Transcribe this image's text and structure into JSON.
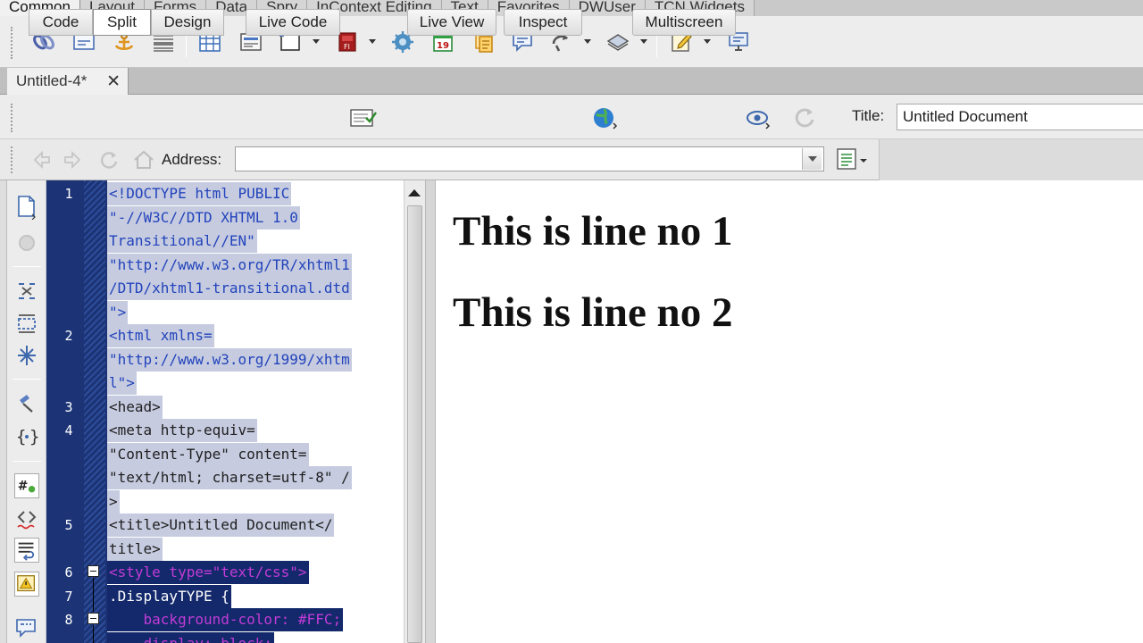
{
  "insert_bar": {
    "tabs": [
      "Common",
      "Layout",
      "Forms",
      "Data",
      "Spry",
      "InContext Editing",
      "Text",
      "Favorites",
      "DWUser",
      "TCN Widgets"
    ],
    "active_tab": "Common",
    "icons": [
      "hyperlink-icon",
      "email-link-icon",
      "named-anchor-icon",
      "horizontal-rule-icon",
      "table-icon",
      "insert-div-icon",
      "images-icon",
      "media-icon",
      "widget-icon",
      "date-icon",
      "server-side-include-icon",
      "comment-icon",
      "head-icon",
      "script-icon",
      "templates-icon",
      "tag-chooser-icon",
      "browser-check-icon"
    ]
  },
  "document": {
    "tab_name": "Untitled-4*",
    "close_glyph": "✕"
  },
  "doc_toolbar": {
    "code_label": "Code",
    "split_label": "Split",
    "design_label": "Design",
    "live_code_label": "Live Code",
    "live_view_label": "Live View",
    "inspect_label": "Inspect",
    "multiscreen_label": "Multiscreen",
    "title_label": "Title:",
    "title_value": "Untitled Document",
    "active_view": "Split"
  },
  "browser_nav": {
    "address_label": "Address:",
    "address_value": ""
  },
  "code_view": {
    "line_numbers": [
      {
        "n": "1",
        "row": 0
      },
      {
        "n": "2",
        "row": 6
      },
      {
        "n": "3",
        "row": 9
      },
      {
        "n": "4",
        "row": 10
      },
      {
        "n": "5",
        "row": 14
      },
      {
        "n": "6",
        "row": 16
      },
      {
        "n": "7",
        "row": 17
      },
      {
        "n": "8",
        "row": 18
      }
    ],
    "rows": [
      "<!DOCTYPE html PUBLIC",
      "\"-//W3C//DTD XHTML 1.0",
      "Transitional//EN\"",
      "\"http://www.w3.org/TR/xhtml1",
      "/DTD/xhtml1-transitional.dtd",
      "\">",
      "<html xmlns=",
      "\"http://www.w3.org/1999/xhtm",
      "l\">",
      "<head>",
      "<meta http-equiv=",
      "\"Content-Type\" content=",
      "\"text/html; charset=utf-8\" /",
      ">",
      "<title>Untitled Document</",
      "title>",
      "<style type=\"text/css\">",
      ".DisplayTYPE {",
      "    background-color: #FFC;",
      "    display: block;"
    ]
  },
  "design_view": {
    "lines": [
      "This is line no 1",
      "This is line no 2"
    ]
  }
}
